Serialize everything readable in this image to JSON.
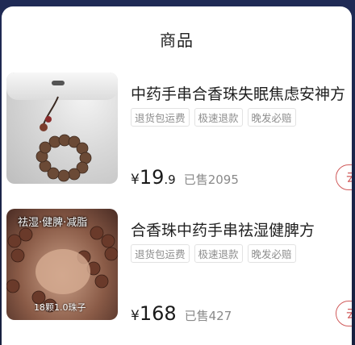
{
  "sheet": {
    "title": "商品"
  },
  "items": [
    {
      "title": "中药手串合香珠失眠焦虑安神方",
      "tags": [
        "退货包运费",
        "极速退款",
        "晚发必赔"
      ],
      "currency": "¥",
      "price_int": "19",
      "price_dec": ".9",
      "sold": "已售2095",
      "button_label": "去",
      "image_overlay_text": "",
      "image_bottom_text": ""
    },
    {
      "title": "合香珠中药手串祛湿健脾方",
      "tags": [
        "退货包运费",
        "极速退款",
        "晚发必赔"
      ],
      "currency": "¥",
      "price_int": "168",
      "price_dec": "",
      "sold": "已售427",
      "button_label": "去",
      "image_overlay_text": "祛湿·健脾·减脂",
      "image_bottom_text": "18颗1.0珠子"
    }
  ],
  "colors": {
    "accent": "#d05a5a",
    "overlay_bg": "#1b2347"
  }
}
